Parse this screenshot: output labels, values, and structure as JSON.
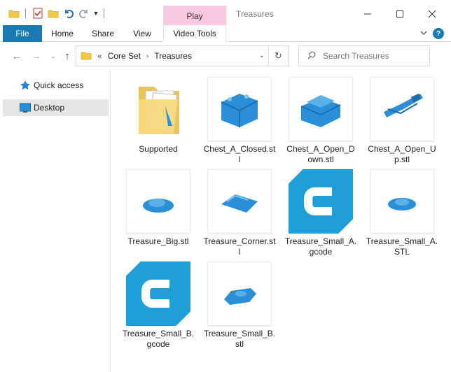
{
  "window": {
    "title": "Treasures",
    "contextual_tab": "Play"
  },
  "ribbon": {
    "tabs": [
      "File",
      "Home",
      "Share",
      "View",
      "Video Tools"
    ]
  },
  "address": {
    "breadcrumbs": [
      "Core Set",
      "Treasures"
    ]
  },
  "search": {
    "placeholder": "Search Treasures"
  },
  "sidebar": {
    "items": [
      {
        "label": "Quick access",
        "icon": "star-icon"
      },
      {
        "label": "Desktop",
        "icon": "desktop-icon"
      }
    ]
  },
  "files": [
    {
      "name": "Supported",
      "kind": "folder"
    },
    {
      "name": "Chest_A_Closed.stl",
      "kind": "stl"
    },
    {
      "name": "Chest_A_Open_Down.stl",
      "kind": "stl"
    },
    {
      "name": "Chest_A_Open_Up.stl",
      "kind": "stl"
    },
    {
      "name": "Treasure_Big.stl",
      "kind": "stl"
    },
    {
      "name": "Treasure_Corner.stl",
      "kind": "stl"
    },
    {
      "name": "Treasure_Small_A.gcode",
      "kind": "gcode"
    },
    {
      "name": "Treasure_Small_A.STL",
      "kind": "stl"
    },
    {
      "name": "Treasure_Small_B.gcode",
      "kind": "gcode"
    },
    {
      "name": "Treasure_Small_B.stl",
      "kind": "stl"
    }
  ],
  "colors": {
    "file_tab": "#1a79b0",
    "play_context": "#f8c8e0",
    "model_blue": "#2a8fd6",
    "cura_blue": "#1e9fd9"
  }
}
